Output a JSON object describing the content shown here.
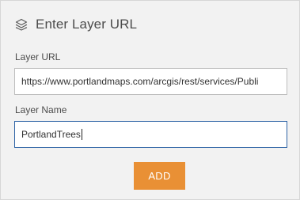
{
  "header": {
    "icon": "layers-icon",
    "title": "Enter Layer URL"
  },
  "fields": {
    "url": {
      "label": "Layer URL",
      "value": "https://www.portlandmaps.com/arcgis/rest/services/Publi"
    },
    "name": {
      "label": "Layer Name",
      "value": "PortlandTrees"
    }
  },
  "actions": {
    "add_label": "ADD"
  },
  "colors": {
    "panel_bg": "#f2f2f2",
    "accent_button": "#e99035",
    "focus_border": "#2e63a5",
    "text": "#4c4c4c"
  }
}
